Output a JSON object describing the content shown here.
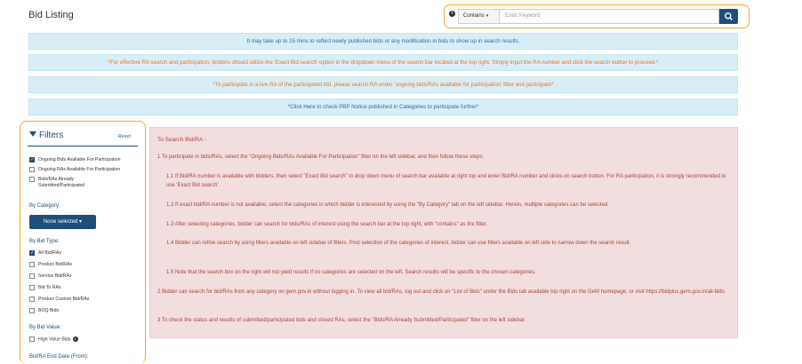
{
  "header": {
    "title": "Bid Listing"
  },
  "search": {
    "info_icon": "info-icon",
    "mode": "Contains",
    "placeholder": "Enter Keyword",
    "button_icon": "search-icon"
  },
  "notices": [
    "It may take up to 15 mins to reflect newly published bids or any modification in bids to show up in search results.",
    "*For effective RA search and participation, bidders should utilize the 'Exact Bid search' option in the dropdown menu of the search bar located at the top right. Simply input the RA number and click the search button to proceed.*",
    "*To participate in a live RA of the participated bid, please search RA under 'ongoing bids/RAs available for participation' filter and participate*"
  ],
  "notice4": {
    "pre": "*Click ",
    "link1": "Here",
    "mid": " to check PBP Notice published in ",
    "link2": "Categories",
    "post": " to participate further*"
  },
  "filters": {
    "title": "Filters",
    "reset": "Reset",
    "status_options": [
      {
        "label": "Ongoing Bids Available For Participation",
        "checked": true
      },
      {
        "label": "Ongoing RAs Available For Participation",
        "checked": false
      },
      {
        "label": "Bids/RAs Already Submitted/Participated",
        "checked": false
      }
    ],
    "category_label": "By Category:",
    "category_button": "None selected",
    "bid_type_label": "By Bid Type:",
    "bid_types": [
      {
        "label": "All Bid/RAs",
        "checked": true
      },
      {
        "label": "Product Bid/RAs",
        "checked": false
      },
      {
        "label": "Service Bid/RAs",
        "checked": false
      },
      {
        "label": "Bid To RAs",
        "checked": false
      },
      {
        "label": "Product Custom Bid/RAs",
        "checked": false
      },
      {
        "label": "BOQ Bids",
        "checked": false
      }
    ],
    "bid_value_label": "By Bid Value:",
    "high_value": {
      "label": "High Value Bids",
      "checked": false
    },
    "end_date_label": "Bid/RA End Date (From):"
  },
  "guide": {
    "heading": "To Search Bid/RA :",
    "p1": "1  To participate in bids/RAs, select the \"Ongoing Bids/RAs Available For Participation\" filter on the left sidebar, and then follow these steps:",
    "p11": "1.1  If Bid/RA number is available with bidders, then select \"Exact Bid search\" in drop down menu of search bar available at right top and enter Bid/RA number and clicks on search button. For RA participation, it is strongly recommended to use 'Exact Bid search'.",
    "p12": "1.2  If exact bid/RA number is not available, select the categories in which bidder is interested by using the \"By Category\" tab on the left sidebar. Herein, multiple categories can be selected.",
    "p13": "1.3  After selecting categories, bidder can search for bids/RAs of interest using the search bar at the top right, with \"contains\" as the filter.",
    "p14": "1.4  Bidder can refine search by using filters available on left sidebar of filters. Post selection of the categories of interest, bidder can use filters available on left side to narrow down the search result.",
    "p15": "1.5  Note that the search box on the right will not yield results if no categories are selected on the left. Search results will be specific to the chosen categories.",
    "p2": "2  Bidder can search for bid/RAs from any category on gem.gov.in without logging in. To view all bid/RAs, log out and click on \"List of Bids\" under the Bids tab available top right on the GeM homepage, or visit https://bidplus.gem.gov.in/all-bids.",
    "p3": "3  To check the status and results of submitted/participated bids and closed RAs, select the \"Bids/RA Already Submitted/Participated\" filter on the left sidebar."
  }
}
